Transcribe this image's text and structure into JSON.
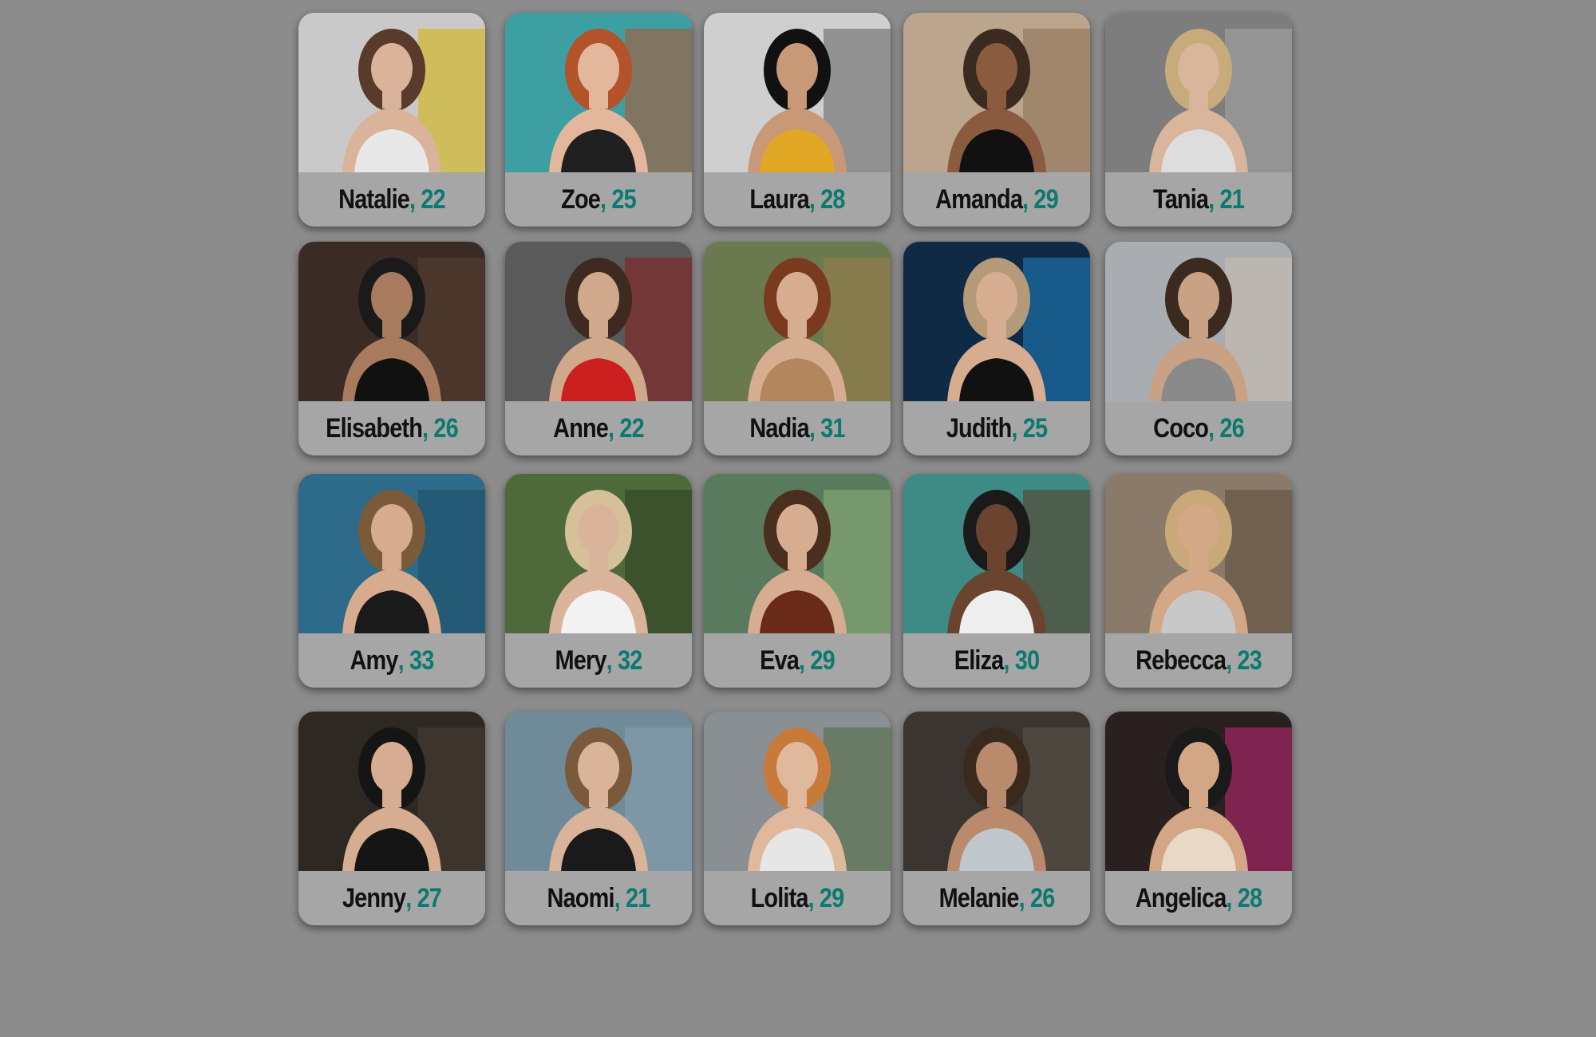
{
  "profiles": [
    {
      "name": "Natalie",
      "age_text": ", 22",
      "photo": {
        "bg": "#c9c9c9",
        "accent": "#d4b000",
        "hair": "#5a3a2a",
        "skin": "#d9b49a",
        "cloth": "#e8e8e8"
      }
    },
    {
      "name": "Zoe",
      "age_text": ", 25",
      "photo": {
        "bg": "#3e9fa3",
        "accent": "#b5522a",
        "hair": "#b4522a",
        "skin": "#e2b79c",
        "cloth": "#202020"
      }
    },
    {
      "name": "Laura",
      "age_text": ", 28",
      "photo": {
        "bg": "#cfcfcf",
        "accent": "#5e5e5e",
        "hair": "#111111",
        "skin": "#c99877",
        "cloth": "#e1a826"
      }
    },
    {
      "name": "Amanda",
      "age_text": ", 29",
      "photo": {
        "bg": "#bba58d",
        "accent": "#8a6e53",
        "hair": "#3a2a20",
        "skin": "#8a5b3f",
        "cloth": "#111111"
      }
    },
    {
      "name": "Tania",
      "age_text": ", 21",
      "photo": {
        "bg": "#7d7d7d",
        "accent": "#a7a7a7",
        "hair": "#c7ab7a",
        "skin": "#d9b59b",
        "cloth": "#dddddd"
      }
    },
    {
      "name": "Elisabeth",
      "age_text": ", 26",
      "photo": {
        "bg": "#3a2c25",
        "accent": "#5a4032",
        "hair": "#1a1a1a",
        "skin": "#a87a5e",
        "cloth": "#111111"
      }
    },
    {
      "name": "Anne",
      "age_text": ", 22",
      "photo": {
        "bg": "#5a5a5a",
        "accent": "#8a1c1c",
        "hair": "#3e2a20",
        "skin": "#d0a88c",
        "cloth": "#cc1f1f"
      }
    },
    {
      "name": "Nadia",
      "age_text": ", 31",
      "photo": {
        "bg": "#6b7a4e",
        "accent": "#9c7b4a",
        "hair": "#7a3a20",
        "skin": "#d7ad92",
        "cloth": "#b3865e"
      }
    },
    {
      "name": "Judith",
      "age_text": ", 25",
      "photo": {
        "bg": "#0f2a45",
        "accent": "#1f7fbf",
        "hair": "#b59a7a",
        "skin": "#d7ad92",
        "cloth": "#111111"
      }
    },
    {
      "name": "Coco",
      "age_text": ", 26",
      "photo": {
        "bg": "#a9adb2",
        "accent": "#cbbfae",
        "hair": "#3a2a20",
        "skin": "#c9a184",
        "cloth": "#8a8a8a"
      }
    },
    {
      "name": "Amy",
      "age_text": ", 33",
      "photo": {
        "bg": "#2e6a8a",
        "accent": "#1e4c66",
        "hair": "#7b5a3a",
        "skin": "#d6ab8e",
        "cloth": "#1a1a1a"
      }
    },
    {
      "name": "Mery",
      "age_text": ", 32",
      "photo": {
        "bg": "#4e6a3a",
        "accent": "#2e3e22",
        "hair": "#d6c09a",
        "skin": "#d9b49a",
        "cloth": "#f2f2f2"
      }
    },
    {
      "name": "Eva",
      "age_text": ", 29",
      "photo": {
        "bg": "#5a7a5e",
        "accent": "#8fb07a",
        "hair": "#4a2e1e",
        "skin": "#d7ad92",
        "cloth": "#6a2a1a"
      }
    },
    {
      "name": "Eliza",
      "age_text": ", 30",
      "photo": {
        "bg": "#3e8a85",
        "accent": "#5a3a22",
        "hair": "#1a1a1a",
        "skin": "#6b4430",
        "cloth": "#eeeeee"
      }
    },
    {
      "name": "Rebecca",
      "age_text": ", 23",
      "photo": {
        "bg": "#8a7a6a",
        "accent": "#5a4a3a",
        "hair": "#c9a97a",
        "skin": "#d2a887",
        "cloth": "#c8c8c8"
      }
    },
    {
      "name": "Jenny",
      "age_text": ", 27",
      "photo": {
        "bg": "#2e2822",
        "accent": "#4a4036",
        "hair": "#151515",
        "skin": "#d7ad92",
        "cloth": "#151515"
      }
    },
    {
      "name": "Naomi",
      "age_text": ", 21",
      "photo": {
        "bg": "#6f8a99",
        "accent": "#8aa3b0",
        "hair": "#7a5a3a",
        "skin": "#d9b49a",
        "cloth": "#1a1a1a"
      }
    },
    {
      "name": "Lolita",
      "age_text": ", 29",
      "photo": {
        "bg": "#8a8f94",
        "accent": "#4e6a3e",
        "hair": "#c77a3a",
        "skin": "#e0b89c",
        "cloth": "#e6e6e6"
      }
    },
    {
      "name": "Melanie",
      "age_text": ", 26",
      "photo": {
        "bg": "#3a3530",
        "accent": "#5e564e",
        "hair": "#3a2a1e",
        "skin": "#b98a6b",
        "cloth": "#bfc7cc"
      }
    },
    {
      "name": "Angelica",
      "age_text": ", 28",
      "photo": {
        "bg": "#2a2020",
        "accent": "#c4287a",
        "hair": "#1a1a1a",
        "skin": "#d3a686",
        "cloth": "#e8d8c6"
      }
    }
  ]
}
